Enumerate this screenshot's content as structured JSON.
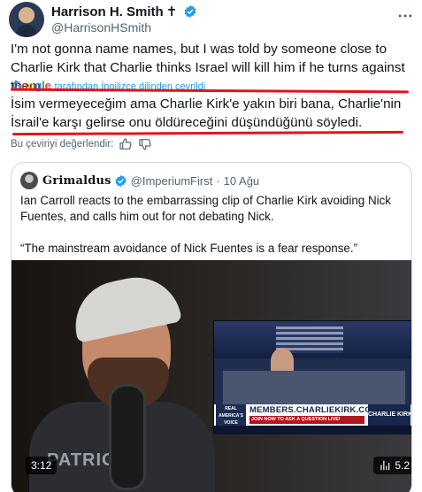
{
  "tweet": {
    "author_name": "Harrison H. Smith",
    "author_suffix": "✝",
    "author_handle": "@HarrisonHSmith",
    "text": "I'm not gonna name names, but I was told by someone close to Charlie Kirk that Charlie thinks Israel will kill him if he turns against them.",
    "translated_by": "tarafından İngilizce dilinden çevrildi",
    "google_logo": [
      "G",
      "o",
      "o",
      "g",
      "l",
      "e"
    ],
    "translated_text": "İsim vermeyeceğim ama Charlie Kirk'e yakın biri bana, Charlie'nin İsrail'e karşı gelirse onu öldüreceğini düşündüğünü söyledi.",
    "rate_translation": "Bu çeviriyi değerlendir:"
  },
  "quote": {
    "author_name": "Grimaldus",
    "author_handle": "@ImperiumFirst",
    "separator": "·",
    "date": "10 Ağu",
    "paragraph_1": "Ian Carroll reacts to the embarrassing clip of Charlie Kirk avoiding Nick Fuentes, and calls him out for not debating Nick.",
    "paragraph_2": "“The mainstream avoidance of Nick Fuentes is a fear response.”",
    "video": {
      "duration": "3:12",
      "views": "5.2",
      "lower_third_url": "MEMBERS.CHARLIEKIRK.COM",
      "lower_third_sub": "JOIN NOW TO ASK A QUESTION LIVE!",
      "lower_third_show": "CHARLIE KIRK",
      "lower_third_logo": "REAL AMERICA'S VOICE",
      "shirt_text": "PATRIOT"
    }
  },
  "colors": {
    "accent": "#1d9bf0",
    "underline": "#e0141e",
    "secondary_text": "#536471"
  },
  "icons": {
    "verified": "verified-badge-icon",
    "more": "more-options-icon",
    "thumbs_up": "thumbs-up-icon",
    "thumbs_down": "thumbs-down-icon",
    "views": "views-icon"
  }
}
